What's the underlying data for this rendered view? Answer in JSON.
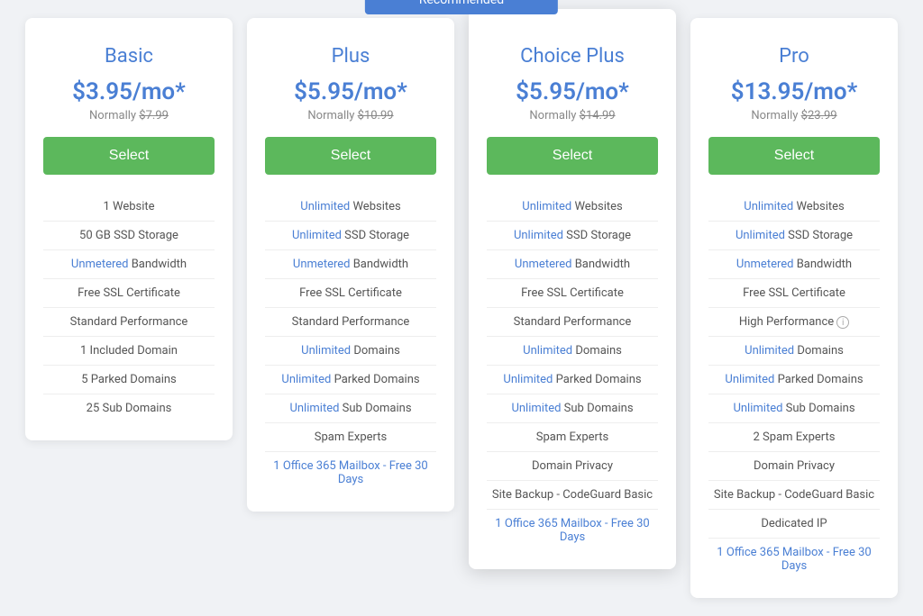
{
  "badge": {
    "label": "Recommended"
  },
  "plans": [
    {
      "id": "basic",
      "name": "Basic",
      "price": "$3.95/mo*",
      "normal_price": "$7.99",
      "select_label": "Select",
      "featured": false,
      "features": [
        {
          "text": "1 Website",
          "highlight": false
        },
        {
          "text": "50 GB SSD Storage",
          "highlight": false
        },
        {
          "text": "Bandwidth",
          "prefix": "Unmetered",
          "highlight_prefix": true
        },
        {
          "text": "Free SSL Certificate",
          "highlight": false
        },
        {
          "text": "Standard Performance",
          "highlight": false
        },
        {
          "text": "1 Included Domain",
          "highlight": false
        },
        {
          "text": "5 Parked Domains",
          "highlight": false
        },
        {
          "text": "25 Sub Domains",
          "highlight": false
        }
      ]
    },
    {
      "id": "plus",
      "name": "Plus",
      "price": "$5.95/mo*",
      "normal_price": "$10.99",
      "select_label": "Select",
      "featured": false,
      "features": [
        {
          "text": "Websites",
          "prefix": "Unlimited",
          "highlight_prefix": true
        },
        {
          "text": "SSD Storage",
          "prefix": "Unlimited",
          "highlight_prefix": true
        },
        {
          "text": "Bandwidth",
          "prefix": "Unmetered",
          "highlight_prefix": true
        },
        {
          "text": "Free SSL Certificate",
          "highlight": false
        },
        {
          "text": "Standard Performance",
          "highlight": false
        },
        {
          "text": "Domains",
          "prefix": "Unlimited",
          "highlight_prefix": true
        },
        {
          "text": "Parked Domains",
          "prefix": "Unlimited",
          "highlight_prefix": true
        },
        {
          "text": "Sub Domains",
          "prefix": "Unlimited",
          "highlight_prefix": true
        },
        {
          "text": "Spam Experts",
          "highlight": false
        },
        {
          "text": "1 Office 365 Mailbox - Free 30 Days",
          "highlight": true,
          "link": true
        }
      ]
    },
    {
      "id": "choice-plus",
      "name": "Choice Plus",
      "price": "$5.95/mo*",
      "normal_price": "$14.99",
      "select_label": "Select",
      "featured": true,
      "features": [
        {
          "text": "Websites",
          "prefix": "Unlimited",
          "highlight_prefix": true
        },
        {
          "text": "SSD Storage",
          "prefix": "Unlimited",
          "highlight_prefix": true
        },
        {
          "text": "Bandwidth",
          "prefix": "Unmetered",
          "highlight_prefix": true
        },
        {
          "text": "Free SSL Certificate",
          "highlight": false
        },
        {
          "text": "Standard Performance",
          "highlight": false
        },
        {
          "text": "Domains",
          "prefix": "Unlimited",
          "highlight_prefix": true
        },
        {
          "text": "Parked Domains",
          "prefix": "Unlimited",
          "highlight_prefix": true
        },
        {
          "text": "Sub Domains",
          "prefix": "Unlimited",
          "highlight_prefix": true
        },
        {
          "text": "Spam Experts",
          "highlight": false
        },
        {
          "text": "Domain Privacy",
          "highlight": false
        },
        {
          "text": "Site Backup - CodeGuard Basic",
          "highlight": false
        },
        {
          "text": "1 Office 365 Mailbox - Free 30 Days",
          "highlight": true,
          "link": true
        }
      ]
    },
    {
      "id": "pro",
      "name": "Pro",
      "price": "$13.95/mo*",
      "normal_price": "$23.99",
      "select_label": "Select",
      "featured": false,
      "features": [
        {
          "text": "Websites",
          "prefix": "Unlimited",
          "highlight_prefix": true
        },
        {
          "text": "SSD Storage",
          "prefix": "Unlimited",
          "highlight_prefix": true
        },
        {
          "text": "Bandwidth",
          "prefix": "Unmetered",
          "highlight_prefix": true
        },
        {
          "text": "Free SSL Certificate",
          "highlight": false
        },
        {
          "text": "High Performance",
          "highlight": false,
          "info": true
        },
        {
          "text": "Domains",
          "prefix": "Unlimited",
          "highlight_prefix": true
        },
        {
          "text": "Parked Domains",
          "prefix": "Unlimited",
          "highlight_prefix": true
        },
        {
          "text": "Sub Domains",
          "prefix": "Unlimited",
          "highlight_prefix": true
        },
        {
          "text": "2 Spam Experts",
          "highlight": false
        },
        {
          "text": "Domain Privacy",
          "highlight": false
        },
        {
          "text": "Site Backup - CodeGuard Basic",
          "highlight": false
        },
        {
          "text": "Dedicated IP",
          "highlight": false
        },
        {
          "text": "1 Office 365 Mailbox - Free 30 Days",
          "highlight": true,
          "link": true
        }
      ]
    }
  ]
}
